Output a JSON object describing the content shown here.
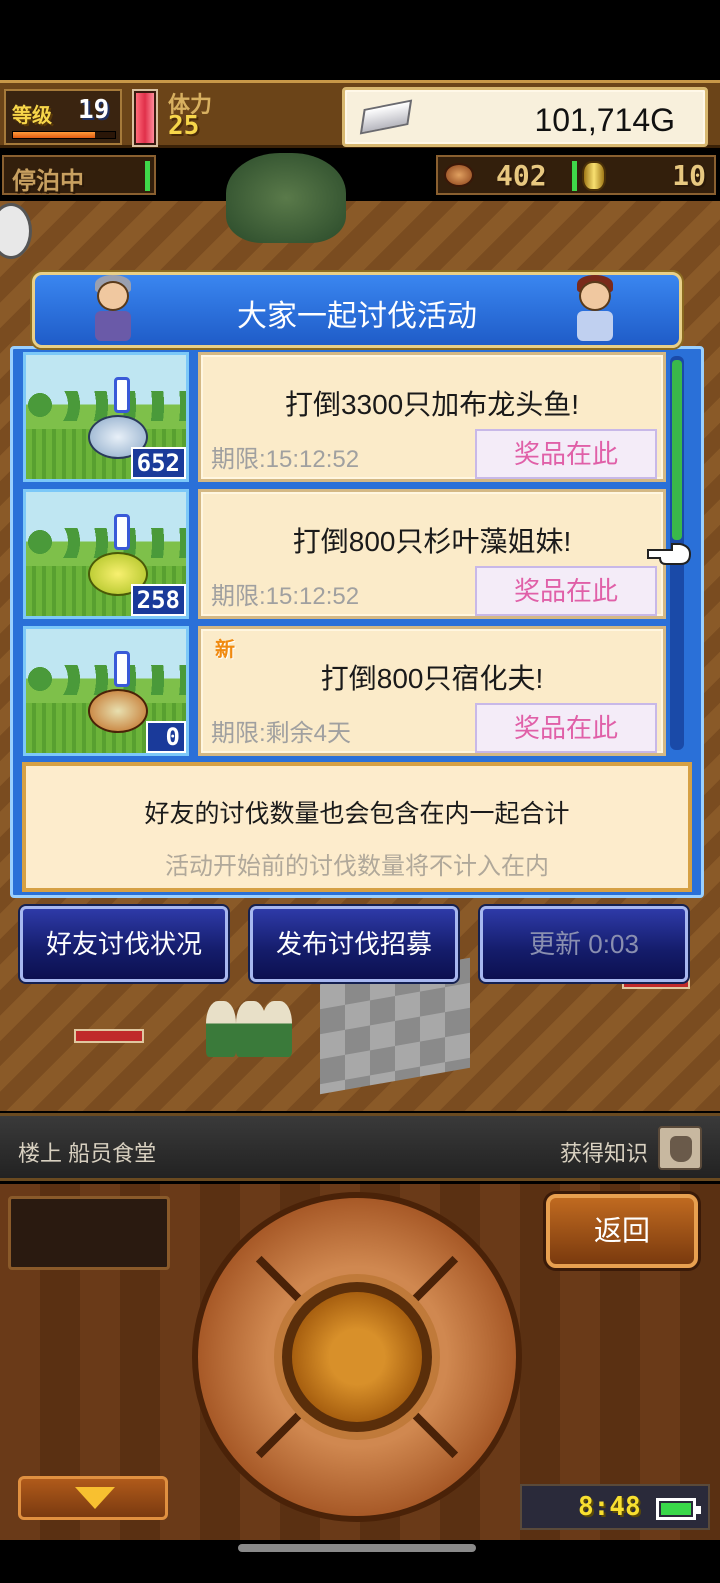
{
  "hud": {
    "level_label": "等级",
    "level": "19",
    "stamina_label": "体力",
    "stamina": "25",
    "gold": "101,714G"
  },
  "status": {
    "docked_label": "停泊中",
    "resource_1": "402",
    "resource_2": "10"
  },
  "panel": {
    "title": "大家一起讨伐活动",
    "events": [
      {
        "title": "打倒3300只加布龙头鱼!",
        "deadline": "期限:15:12:52",
        "prize_label": "奖品在此",
        "count": "652",
        "new": ""
      },
      {
        "title": "打倒800只杉叶藻姐妹!",
        "deadline": "期限:15:12:52",
        "prize_label": "奖品在此",
        "count": "258",
        "new": ""
      },
      {
        "title": "打倒800只宿化夫!",
        "deadline": "期限:剩余4天",
        "prize_label": "奖品在此",
        "count": "0",
        "new": "新"
      }
    ],
    "info_main": "好友的讨伐数量也会包含在内一起合计",
    "info_sub": "活动开始前的讨伐数量将不计入在内"
  },
  "buttons": {
    "friends_status": "好友讨伐状况",
    "post_recruit": "发布讨伐招募",
    "refresh": "更新 0:03"
  },
  "location": {
    "place": "楼上 船员食堂",
    "knowledge": "获得知识"
  },
  "console": {
    "back": "返回",
    "clock": "8:48"
  },
  "colors": {
    "panel_blue": "#2a70d8",
    "card_bg": "#fbebc9",
    "prize_text": "#e060a8",
    "button_navy": "#141c6a"
  }
}
